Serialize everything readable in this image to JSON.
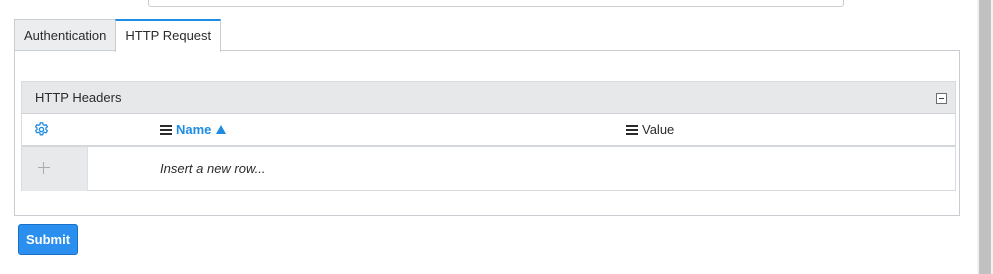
{
  "tabs": [
    {
      "label": "Authentication",
      "active": false
    },
    {
      "label": "HTTP Request",
      "active": true
    }
  ],
  "list": {
    "title": "HTTP Headers",
    "columns": {
      "name": "Name",
      "value": "Value",
      "sort": "ascending"
    },
    "insert_row_placeholder": "Insert a new row..."
  },
  "icons": {
    "settings": "gear-icon",
    "collapse": "minus-box-icon",
    "column_menu": "hamburger-menu-icon",
    "sort": "sort-ascending-arrow-icon",
    "add": "plus-icon"
  },
  "buttons": {
    "submit": "Submit"
  },
  "colors": {
    "accent": "#1f8ce3",
    "submit_bg": "#2b8ff0",
    "header_bg": "#e7e8ea"
  }
}
